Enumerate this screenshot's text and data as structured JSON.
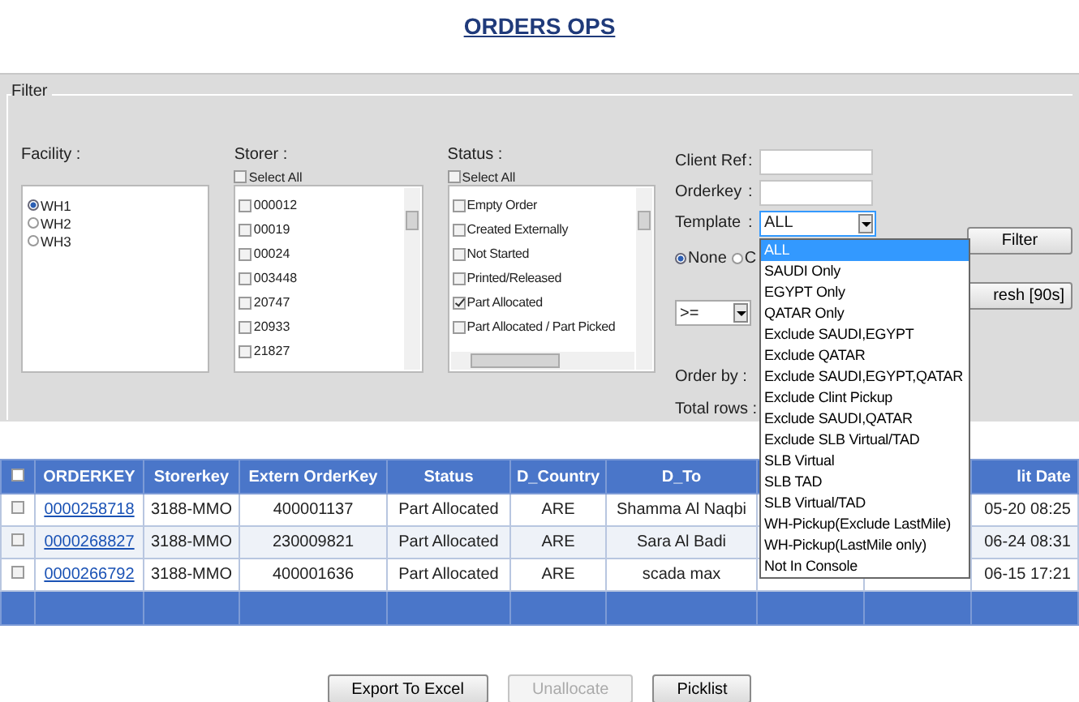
{
  "title": "ORDERS OPS",
  "filter": {
    "legend": "Filter",
    "facility": {
      "label": "Facility :",
      "options": [
        {
          "label": "WH1",
          "selected": true
        },
        {
          "label": "WH2",
          "selected": false
        },
        {
          "label": "WH3",
          "selected": false
        }
      ]
    },
    "storer": {
      "label": "Storer :",
      "select_all": {
        "label": "Select All",
        "checked": false
      },
      "items": [
        {
          "label": "000012",
          "checked": false
        },
        {
          "label": "00019",
          "checked": false
        },
        {
          "label": "00024",
          "checked": false
        },
        {
          "label": "003448",
          "checked": false
        },
        {
          "label": "20747",
          "checked": false
        },
        {
          "label": "20933",
          "checked": false
        },
        {
          "label": "21827",
          "checked": false
        }
      ]
    },
    "status": {
      "label": "Status :",
      "select_all": {
        "label": "Select All",
        "checked": false
      },
      "items": [
        {
          "label": "Empty Order",
          "checked": false
        },
        {
          "label": "Created Externally",
          "checked": false
        },
        {
          "label": "Not Started",
          "checked": false
        },
        {
          "label": "Printed/Released",
          "checked": false
        },
        {
          "label": "Part Allocated",
          "checked": true
        },
        {
          "label": "Part Allocated / Part Picked",
          "checked": false
        }
      ]
    },
    "client_ref": {
      "label": "Client Ref",
      "separator": ":"
    },
    "orderkey": {
      "label": "Orderkey",
      "separator": ":"
    },
    "template": {
      "label": "Template",
      "separator": ":",
      "value": "ALL",
      "expanded": true,
      "options": [
        {
          "label": "ALL",
          "selected": true
        },
        {
          "label": "SAUDI Only",
          "selected": false
        },
        {
          "label": "EGYPT Only",
          "selected": false
        },
        {
          "label": "QATAR Only",
          "selected": false
        },
        {
          "label": "Exclude SAUDI,EGYPT",
          "selected": false
        },
        {
          "label": "Exclude QATAR",
          "selected": false
        },
        {
          "label": "Exclude SAUDI,EGYPT,QATAR",
          "selected": false
        },
        {
          "label": "Exclude Clint Pickup",
          "selected": false
        },
        {
          "label": "Exclude SAUDI,QATAR",
          "selected": false
        },
        {
          "label": "Exclude SLB Virtual/TAD",
          "selected": false
        },
        {
          "label": "SLB Virtual",
          "selected": false
        },
        {
          "label": "SLB TAD",
          "selected": false
        },
        {
          "label": "SLB Virtual/TAD",
          "selected": false
        },
        {
          "label": "WH-Pickup(Exclude LastMile)",
          "selected": false
        },
        {
          "label": "WH-Pickup(LastMile only)",
          "selected": false
        },
        {
          "label": "Not In Console",
          "selected": false
        }
      ]
    },
    "mode_radios": [
      {
        "label": "None",
        "selected": true
      },
      {
        "label": "C",
        "selected": false
      }
    ],
    "operator": {
      "value": ">="
    },
    "order_by": {
      "label": "Order by :"
    },
    "total_rows": {
      "label": "Total rows :"
    },
    "filter_button": {
      "label": "Filter"
    },
    "refresh_button": {
      "label": "resh [90s]"
    }
  },
  "table": {
    "columns": [
      "ORDERKEY",
      "Storerkey",
      "Extern OrderKey",
      "Status",
      "D_Country",
      "D_To",
      "lit Date"
    ],
    "header_checked": false,
    "rows": [
      {
        "checked": false,
        "cells": [
          "0000258718",
          "3188-MMO",
          "400001137",
          "Part Allocated",
          "ARE",
          "Shamma Al Naqbi",
          "05-20 08:25"
        ]
      },
      {
        "checked": false,
        "cells": [
          "0000268827",
          "3188-MMO",
          "230009821",
          "Part Allocated",
          "ARE",
          "Sara Al Badi",
          "06-24 08:31"
        ]
      },
      {
        "checked": false,
        "cells": [
          "0000266792",
          "3188-MMO",
          "400001636",
          "Part Allocated",
          "ARE",
          "scada max",
          "06-15 17:21"
        ]
      }
    ]
  },
  "actions": [
    {
      "label": "Export To Excel",
      "disabled": false
    },
    {
      "label": "Unallocate",
      "disabled": true
    },
    {
      "label": "Picklist",
      "disabled": false
    }
  ]
}
